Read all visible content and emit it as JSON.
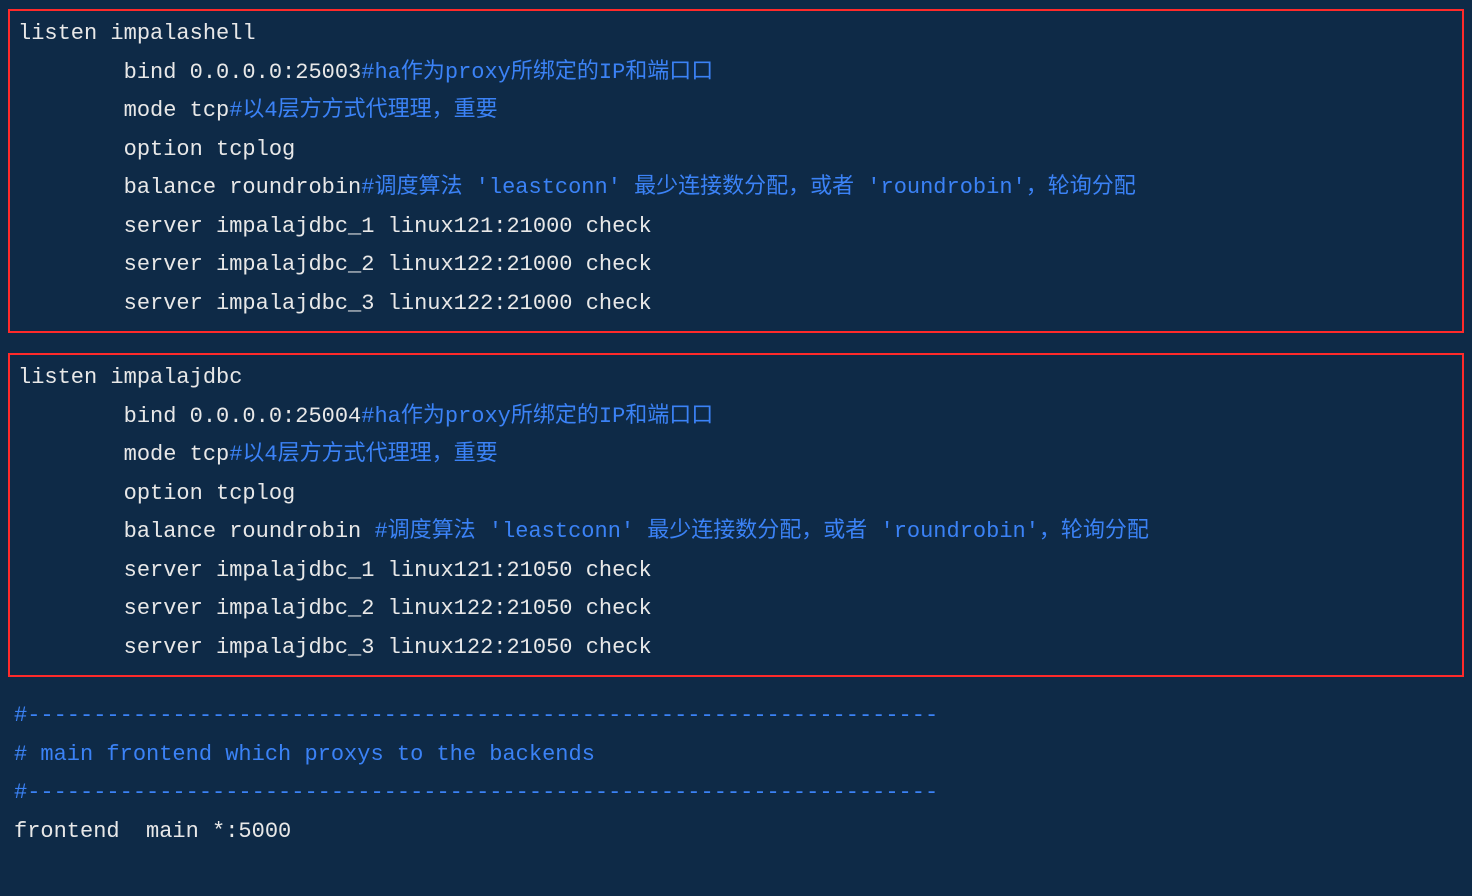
{
  "block1": {
    "l1": "listen impalashell",
    "l2": "        bind 0.0.0.0:25003",
    "l2c": "#ha作为proxy所绑定的IP和端口口",
    "l3": "        mode tcp",
    "l3c": "#以4层方方式代理理，重要",
    "l4": "        option tcplog",
    "l5": "        balance roundrobin",
    "l5c": "#调度算法 'leastconn' 最少连接数分配，或者 'roundrobin'，轮询分配",
    "l6": "        server impalajdbc_1 linux121:21000 check",
    "l7": "        server impalajdbc_2 linux122:21000 check",
    "l8": "        server impalajdbc_3 linux122:21000 check"
  },
  "block2": {
    "l1": "listen impalajdbc",
    "l2": "        bind 0.0.0.0:25004",
    "l2c": "#ha作为proxy所绑定的IP和端口口",
    "l3": "        mode tcp",
    "l3c": "#以4层方方式代理理，重要",
    "l4": "        option tcplog",
    "l5": "        balance roundrobin ",
    "l5c": "#调度算法 'leastconn' 最少连接数分配，或者 'roundrobin'，轮询分配",
    "l6": "        server impalajdbc_1 linux121:21050 check",
    "l7": "        server impalajdbc_2 linux122:21050 check",
    "l8": "        server impalajdbc_3 linux122:21050 check"
  },
  "footer": {
    "sep1": "#---------------------------------------------------------------------",
    "desc": "# main frontend which proxys to the backends",
    "sep2": "#---------------------------------------------------------------------",
    "frontend": "frontend  main *:5000"
  }
}
